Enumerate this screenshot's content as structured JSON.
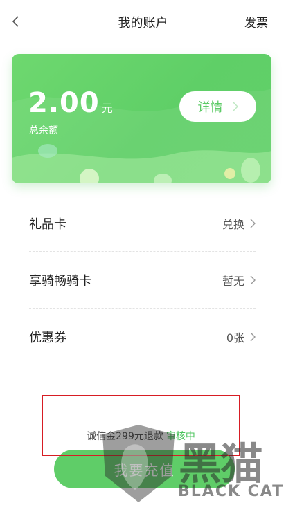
{
  "nav": {
    "title": "我的账户",
    "invoice_label": "发票"
  },
  "balance": {
    "amount": "2.00",
    "unit": "元",
    "label": "总余额",
    "detail_label": "详情"
  },
  "list": {
    "items": [
      {
        "label": "礼品卡",
        "value": "兑换"
      },
      {
        "label": "享骑畅骑卡",
        "value": "暂无"
      },
      {
        "label": "优惠券",
        "value": "0张"
      }
    ]
  },
  "deposit": {
    "text": "诚信金299元退款",
    "status": "审核中"
  },
  "recharge_label": "我要充值",
  "watermark": {
    "cn": "黑猫",
    "en": "BLACK CAT"
  },
  "colors": {
    "brand_green": "#5fcd68",
    "highlight_red": "#d71d24"
  }
}
